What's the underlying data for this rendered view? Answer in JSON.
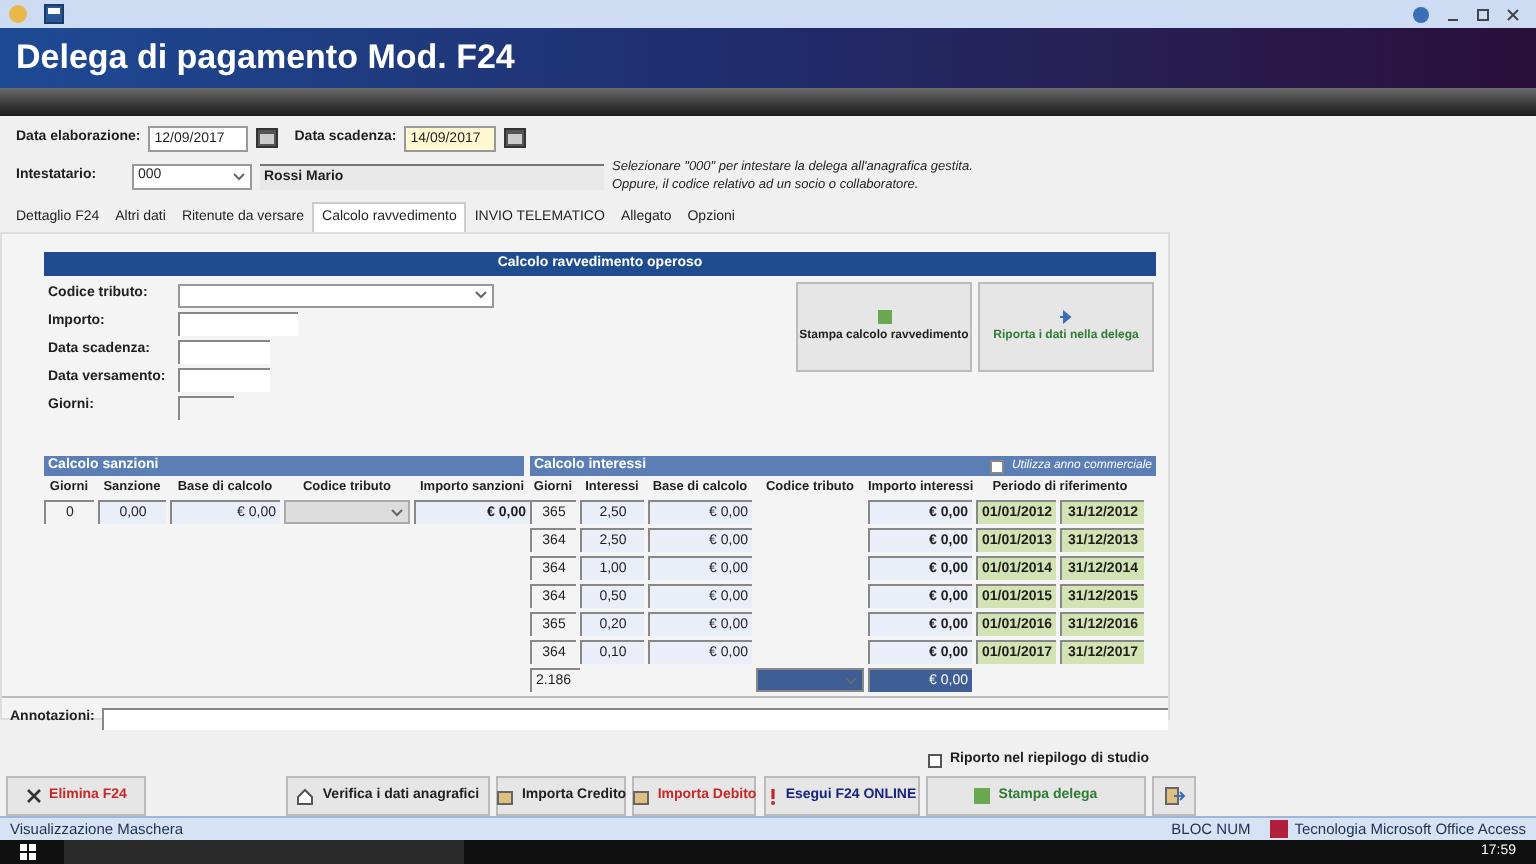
{
  "window": {
    "title": "Delega di pagamento Mod. F24"
  },
  "header": {
    "data_elaborazione": {
      "label": "Data elaborazione:",
      "value": "12/09/2017"
    },
    "data_scadenza": {
      "label": "Data scadenza:",
      "value": "14/09/2017"
    },
    "intestatario": {
      "label": "Intestatario:",
      "code": "000",
      "name": "Rossi Mario"
    },
    "hint": [
      "Selezionare \"000\" per intestare la delega all'anagrafica gestita.",
      "Oppure, il codice relativo ad un socio o collaboratore."
    ]
  },
  "tabs": [
    {
      "label": "Dettaglio F24",
      "selected": false
    },
    {
      "label": "Altri dati",
      "selected": false
    },
    {
      "label": "Ritenute da versare",
      "selected": false
    },
    {
      "label": "Calcolo ravvedimento",
      "selected": true
    },
    {
      "label": "INVIO TELEMATICO",
      "selected": false
    },
    {
      "label": "Allegato",
      "selected": false
    },
    {
      "label": "Opzioni",
      "selected": false
    }
  ],
  "panel": {
    "title": "Calcolo ravvedimento operoso",
    "fields": [
      {
        "label": "Codice tributo:",
        "kind": "dropdown"
      },
      {
        "label": "Importo:",
        "kind": "text"
      },
      {
        "label": "Data scadenza:",
        "kind": "date"
      },
      {
        "label": "Data versamento:",
        "kind": "date"
      },
      {
        "label": "Giorni:",
        "kind": "readonly"
      }
    ],
    "buttons": [
      {
        "label": "Stampa calcolo ravvedimento",
        "color": "#1f1f1f"
      },
      {
        "label": "Riporta i dati nella delega",
        "color": "#2e7d32"
      }
    ]
  },
  "sanzioni": {
    "title": "Calcolo sanzioni",
    "columns": [
      "Giorni",
      "Sanzione",
      "Base di calcolo",
      "Codice tributo",
      "Importo sanzioni"
    ],
    "row": {
      "giorni": "0",
      "sanzione": "0,00",
      "base": "€ 0,00",
      "importo": "€ 0,00"
    }
  },
  "interessi": {
    "title": "Calcolo interessi",
    "option": {
      "label": "Utilizza anno commerciale",
      "checked": false
    },
    "columns": [
      "Giorni",
      "Interessi",
      "Base di calcolo",
      "Codice tributo",
      "Importo interessi",
      "Periodo di riferimento"
    ],
    "rows": [
      {
        "giorni": "365",
        "interessi": "2,50",
        "base": "€ 0,00",
        "importo": "€ 0,00",
        "dal": "01/01/2012",
        "al": "31/12/2012"
      },
      {
        "giorni": "364",
        "interessi": "2,50",
        "base": "€ 0,00",
        "importo": "€ 0,00",
        "dal": "01/01/2013",
        "al": "31/12/2013"
      },
      {
        "giorni": "364",
        "interessi": "1,00",
        "base": "€ 0,00",
        "importo": "€ 0,00",
        "dal": "01/01/2014",
        "al": "31/12/2014"
      },
      {
        "giorni": "364",
        "interessi": "0,50",
        "base": "€ 0,00",
        "importo": "€ 0,00",
        "dal": "01/01/2015",
        "al": "31/12/2015"
      },
      {
        "giorni": "365",
        "interessi": "0,20",
        "base": "€ 0,00",
        "importo": "€ 0,00",
        "dal": "01/01/2016",
        "al": "31/12/2016"
      },
      {
        "giorni": "364",
        "interessi": "0,10",
        "base": "€ 0,00",
        "importo": "€ 0,00",
        "dal": "01/01/2017",
        "al": "31/12/2017"
      }
    ],
    "total_giorni": "2.186",
    "total_importo": "€ 0,00"
  },
  "annotazioni": {
    "label": "Annotazioni:"
  },
  "riporto": {
    "label": "Riporto nel riepilogo di studio",
    "checked": false
  },
  "buttons": [
    {
      "label": "Elimina F24",
      "kind": "delete",
      "color": "#c62828"
    },
    {
      "label": "Verifica i dati anagrafici",
      "kind": "home",
      "color": "#1f1f1f"
    },
    {
      "label": "Importa Credito",
      "kind": "import",
      "color": "#1f1f1f"
    },
    {
      "label": "Importa Debito",
      "kind": "import",
      "color": "#c62828"
    },
    {
      "label": "Esegui F24 ONLINE",
      "kind": "online",
      "color": "#1a237e"
    },
    {
      "label": "Stampa delega",
      "kind": "print",
      "color": "#2e7d32"
    },
    {
      "kind": "exit"
    }
  ],
  "status_bar": {
    "left": "Visualizzazione Maschera",
    "keys": "BLOC NUM",
    "app": "Tecnologia Microsoft Office Access"
  },
  "taskbar": {
    "time": "17:59"
  }
}
